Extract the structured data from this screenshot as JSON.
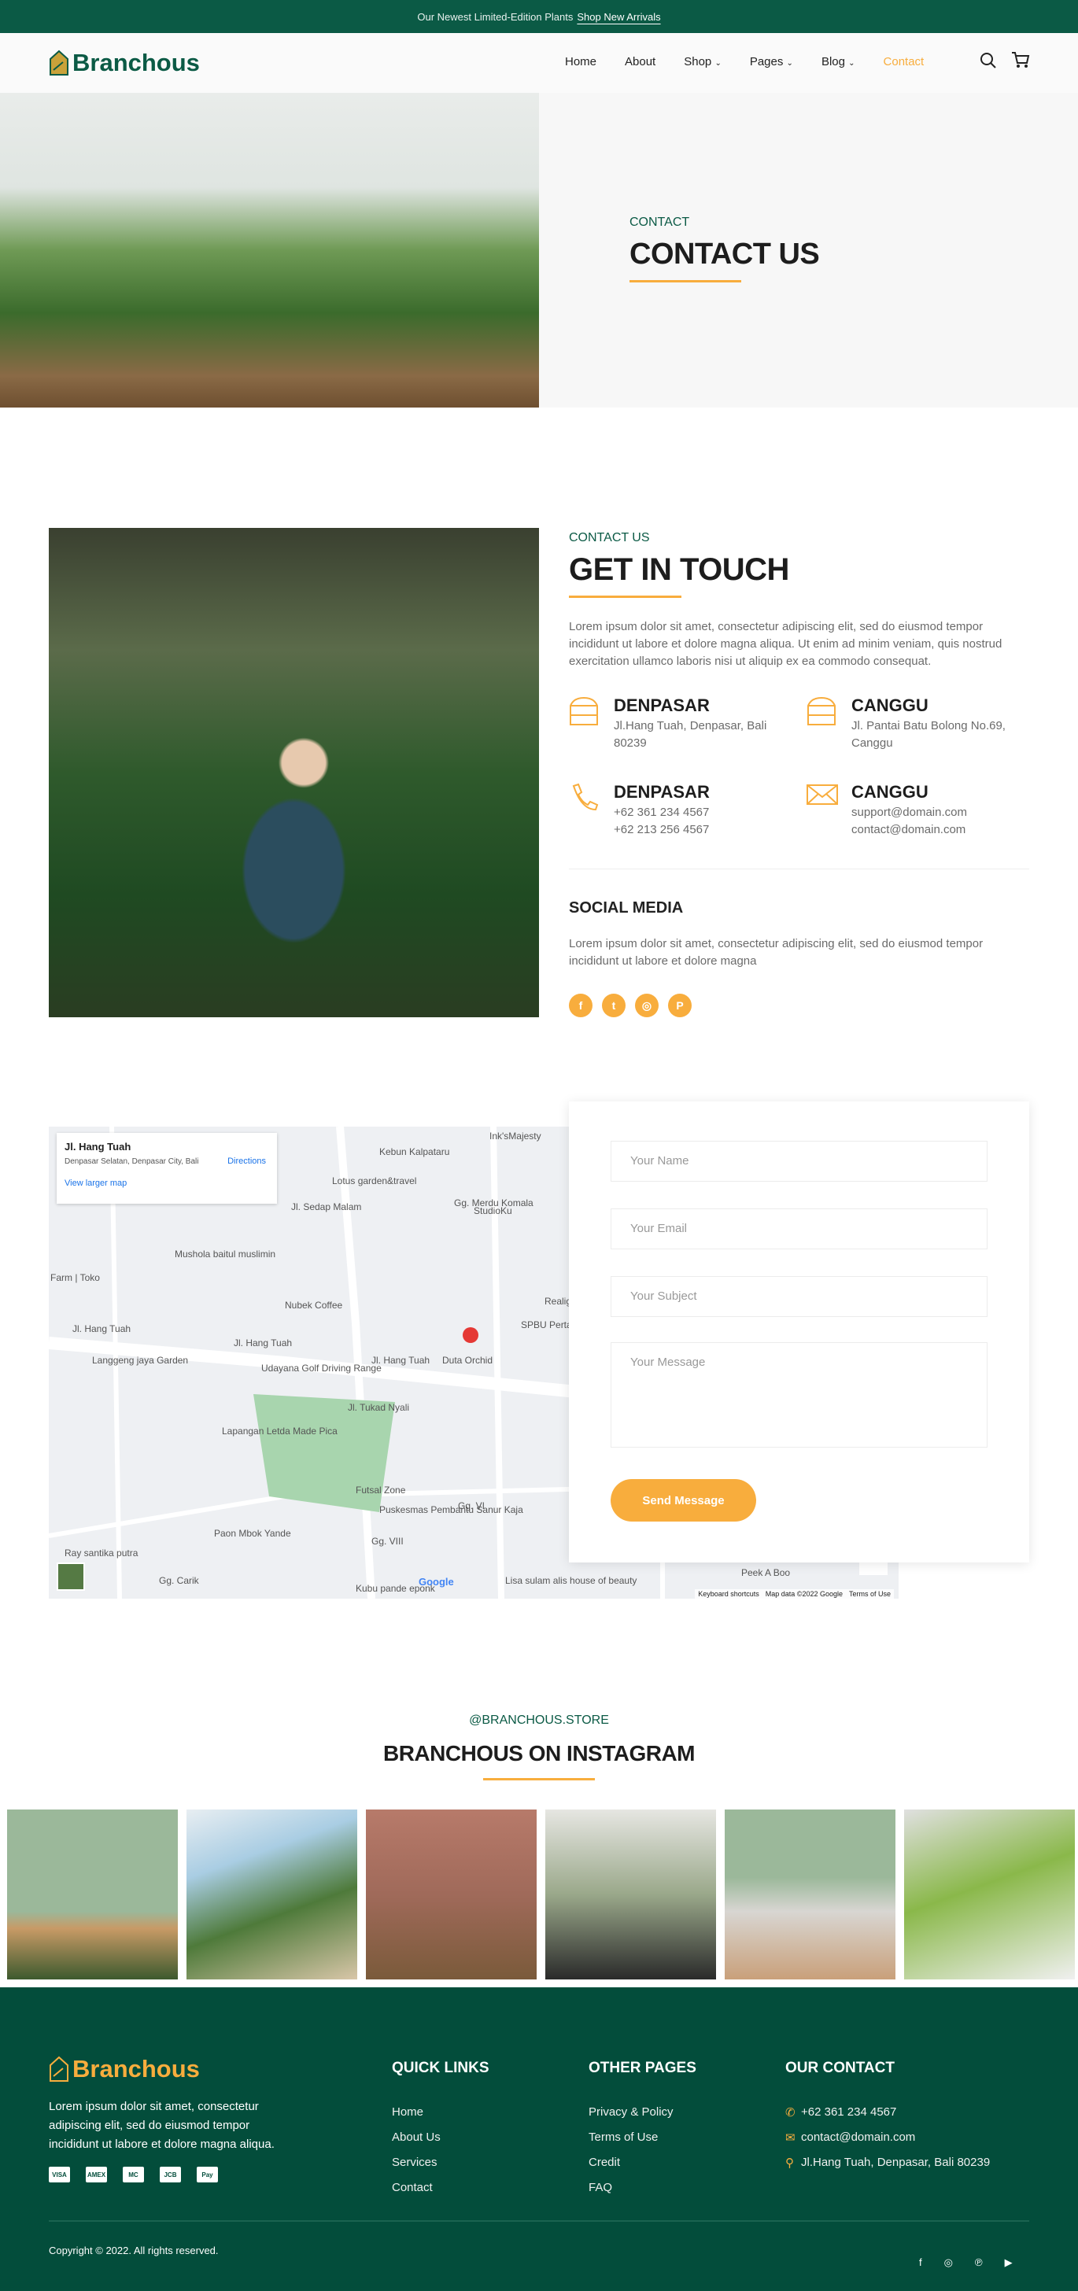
{
  "topbar": {
    "text": "Our Newest Limited-Edition Plants",
    "link": "Shop New Arrivals"
  },
  "header": {
    "logo": "Branchous",
    "nav": [
      "Home",
      "About",
      "Shop",
      "Pages",
      "Blog",
      "Contact"
    ],
    "active": "Contact"
  },
  "hero": {
    "eyebrow": "CONTACT",
    "title": "CONTACT US"
  },
  "touch": {
    "eyebrow": "CONTACT US",
    "title": "GET IN TOUCH",
    "text": "Lorem ipsum dolor sit amet, consectetur adipiscing elit, sed do eiusmod tempor incididunt ut labore et dolore magna aliqua. Ut enim ad minim veniam, quis nostrud exercitation ullamco laboris nisi ut aliquip ex ea commodo consequat.",
    "info": [
      {
        "title": "DENPASAR",
        "lines": [
          "Jl.Hang Tuah, Denpasar, Bali",
          "80239"
        ]
      },
      {
        "title": "CANGGU",
        "lines": [
          "Jl. Pantai Batu Bolong No.69,",
          "Canggu"
        ]
      },
      {
        "title": "DENPASAR",
        "lines": [
          "+62 361 234 4567",
          "+62 213 256 4567"
        ]
      },
      {
        "title": "CANGGU",
        "lines": [
          "support@domain.com",
          "contact@domain.com"
        ]
      }
    ],
    "social_title": "SOCIAL MEDIA",
    "social_text": "Lorem ipsum dolor sit amet, consectetur adipiscing elit, sed do eiusmod tempor incididunt ut labore et dolore magna",
    "social_icons": [
      "f",
      "t",
      "ig",
      "p"
    ]
  },
  "map": {
    "place": "Jl. Hang Tuah",
    "address": "Denpasar Selatan, Denpasar City, Bali",
    "directions": "Directions",
    "larger": "View larger map",
    "labels": [
      "Kebun Kalpataru",
      "Ink'sMajesty",
      "Lotus garden&travel",
      "StudioKu",
      "Mushola baitul muslimin",
      "Farm | Toko",
      "Nubek Coffee",
      "Realign Sanur (Tairopractic)",
      "SPBU Pertamina",
      "Jl. Hang Tuah",
      "Jl. Hang Tuah",
      "Jl. Hang Tuah",
      "Langgeng jaya Garden",
      "Duta Orchid",
      "Udayana Golf Driving Range",
      "Lapangan Letda Made Pica",
      "Futsal Zone",
      "Paon Mbok Yande",
      "Puskesmas Pembantu Sanur Kaja",
      "Ray santika putra",
      "Kubu pande eponk",
      "Lisa sulam alis house of beauty",
      "Peek A Boo",
      "Gg. VI",
      "Gg. VIII",
      "Gg. Carik",
      "Jl. Sedap Malam",
      "Jl. Tukad Nyali",
      "Gg. Merdu Komala"
    ],
    "footer": [
      "Google",
      "Keyboard shortcuts",
      "Map data ©2022 Google",
      "Terms of Use"
    ]
  },
  "form": {
    "name": "Your Name",
    "email": "Your Email",
    "subject": "Your Subject",
    "message": "Your Message",
    "button": "Send Message"
  },
  "instagram": {
    "handle": "@BRANCHOUS.STORE",
    "title": "BRANCHOUS ON INSTAGRAM"
  },
  "footer": {
    "logo": "Branchous",
    "about": "Lorem ipsum dolor sit amet, consectetur adipiscing elit, sed do eiusmod tempor incididunt ut labore et dolore magna aliqua.",
    "payments": [
      "VISA",
      "AMEX",
      "MC",
      "JCB",
      "Pay"
    ],
    "quick_title": "QUICK LINKS",
    "quick": [
      "Home",
      "About Us",
      "Services",
      "Contact"
    ],
    "other_title": "OTHER PAGES",
    "other": [
      "Privacy & Policy",
      "Terms of Use",
      "Credit",
      "FAQ"
    ],
    "contact_title": "OUR CONTACT",
    "contact": [
      "+62 361 234 4567",
      "contact@domain.com",
      "Jl.Hang Tuah, Denpasar, Bali 80239"
    ],
    "copyright": "Copyright © 2022. All rights reserved.",
    "social": [
      "f",
      "ig",
      "p",
      "yt"
    ]
  },
  "colors": {
    "green": "#0b5a45",
    "footer": "#034d3b",
    "accent": "#f8ad3d"
  }
}
